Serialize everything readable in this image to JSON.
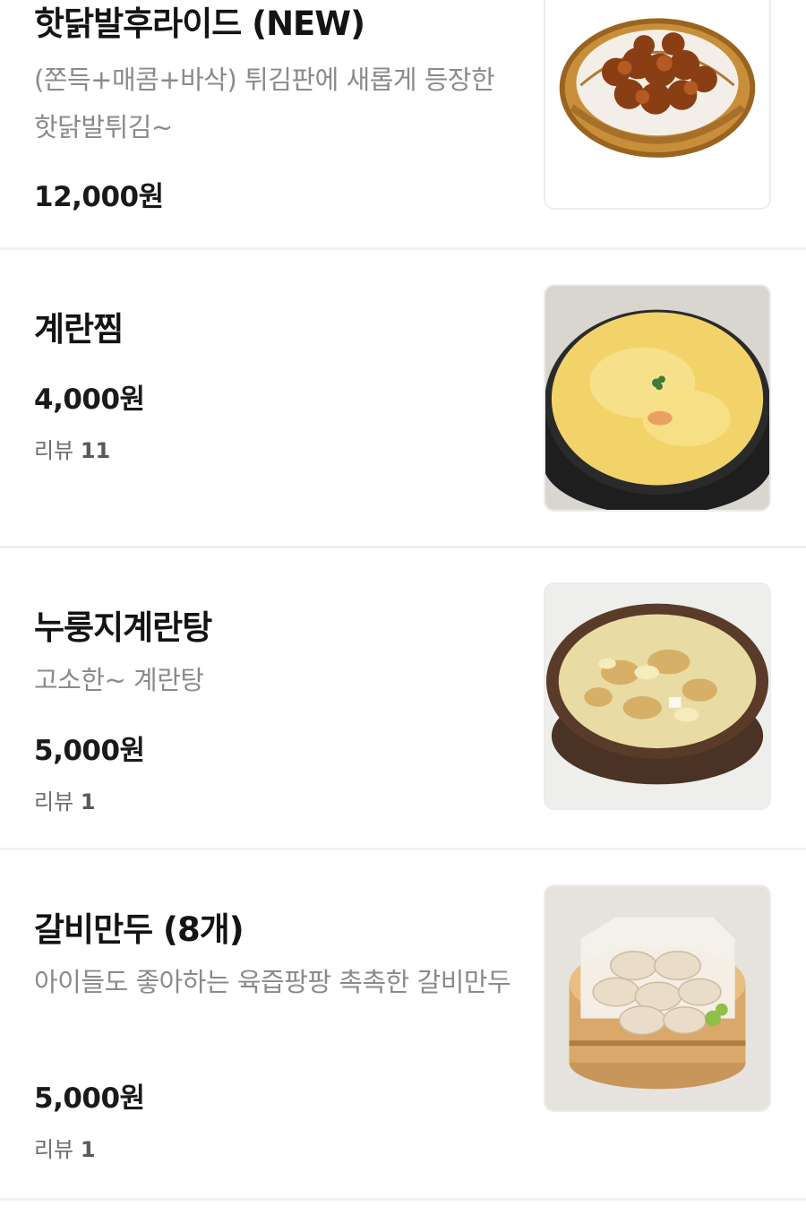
{
  "menu": {
    "items": [
      {
        "title": "핫닭발후라이드 (NEW)",
        "description": "(쫀득+매콤+바삭) 튀김판에 새롭게 등장한 핫닭발튀김~",
        "price": "12,000원",
        "image": "fried-chicken-feet-basket-photo"
      },
      {
        "title": "계란찜",
        "price": "4,000원",
        "review_label": "리뷰",
        "review_count": "11",
        "image": "steamed-egg-stone-pot-photo"
      },
      {
        "title": "누룽지계란탕",
        "description": "고소한~ 계란탕",
        "price": "5,000원",
        "review_label": "리뷰",
        "review_count": "1",
        "image": "scorched-rice-egg-soup-photo"
      },
      {
        "title": "갈비만두 (8개)",
        "description": "아이들도 좋아하는 육즙팡팡 촉촉한 갈비만두",
        "price": "5,000원",
        "review_label": "리뷰",
        "review_count": "1",
        "image": "galbi-dumplings-steamer-photo"
      }
    ]
  }
}
